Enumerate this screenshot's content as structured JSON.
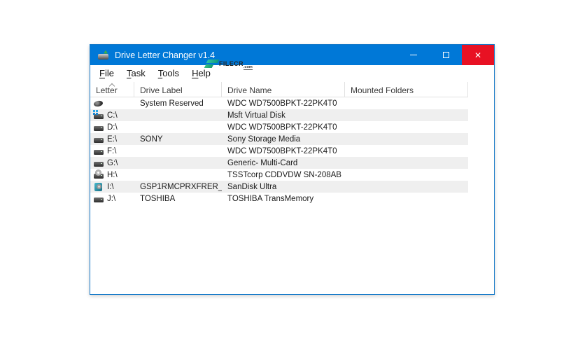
{
  "window": {
    "title": "Drive Letter Changer v1.4",
    "close_glyph": "✕"
  },
  "menu": {
    "items": [
      {
        "label": "File"
      },
      {
        "label": "Task"
      },
      {
        "label": "Tools"
      },
      {
        "label": "Help"
      }
    ]
  },
  "watermark": {
    "text": "FILECR",
    "suffix": ".com"
  },
  "table": {
    "columns": [
      "Letter",
      "Drive Label",
      "Drive Name",
      "Mounted Folders"
    ],
    "sort_column": "Letter",
    "sort_direction": "ascending",
    "rows": [
      {
        "icon": "disk-platter-icon",
        "letter": "",
        "label": "System Reserved",
        "name": "WDC WD7500BPKT-22PK4T0",
        "mounted": ""
      },
      {
        "icon": "system-drive-icon",
        "letter": "C:\\",
        "label": "",
        "name": "Msft Virtual Disk",
        "mounted": ""
      },
      {
        "icon": "hdd-icon",
        "letter": "D:\\",
        "label": "",
        "name": "WDC WD7500BPKT-22PK4T0",
        "mounted": ""
      },
      {
        "icon": "hdd-icon",
        "letter": "E:\\",
        "label": "SONY",
        "name": "Sony Storage Media",
        "mounted": ""
      },
      {
        "icon": "hdd-icon",
        "letter": "F:\\",
        "label": "",
        "name": "WDC WD7500BPKT-22PK4T0",
        "mounted": ""
      },
      {
        "icon": "hdd-icon",
        "letter": "G:\\",
        "label": "",
        "name": "Generic- Multi-Card",
        "mounted": ""
      },
      {
        "icon": "cd-drive-icon",
        "letter": "H:\\",
        "label": "",
        "name": "TSSTcorp CDDVDW SN-208AB",
        "mounted": ""
      },
      {
        "icon": "removable-drive-icon",
        "letter": "I:\\",
        "label": "GSP1RMCPRXFRER_...",
        "name": "SanDisk Ultra",
        "mounted": ""
      },
      {
        "icon": "hdd-icon",
        "letter": "J:\\",
        "label": "TOSHIBA",
        "name": "TOSHIBA TransMemory",
        "mounted": ""
      }
    ]
  },
  "colors": {
    "titlebar": "#0078d7",
    "close_button": "#e81123",
    "row_stripe": "#efefef",
    "window_border": "#1579c8",
    "watermark_teal": "#1aa98b"
  }
}
